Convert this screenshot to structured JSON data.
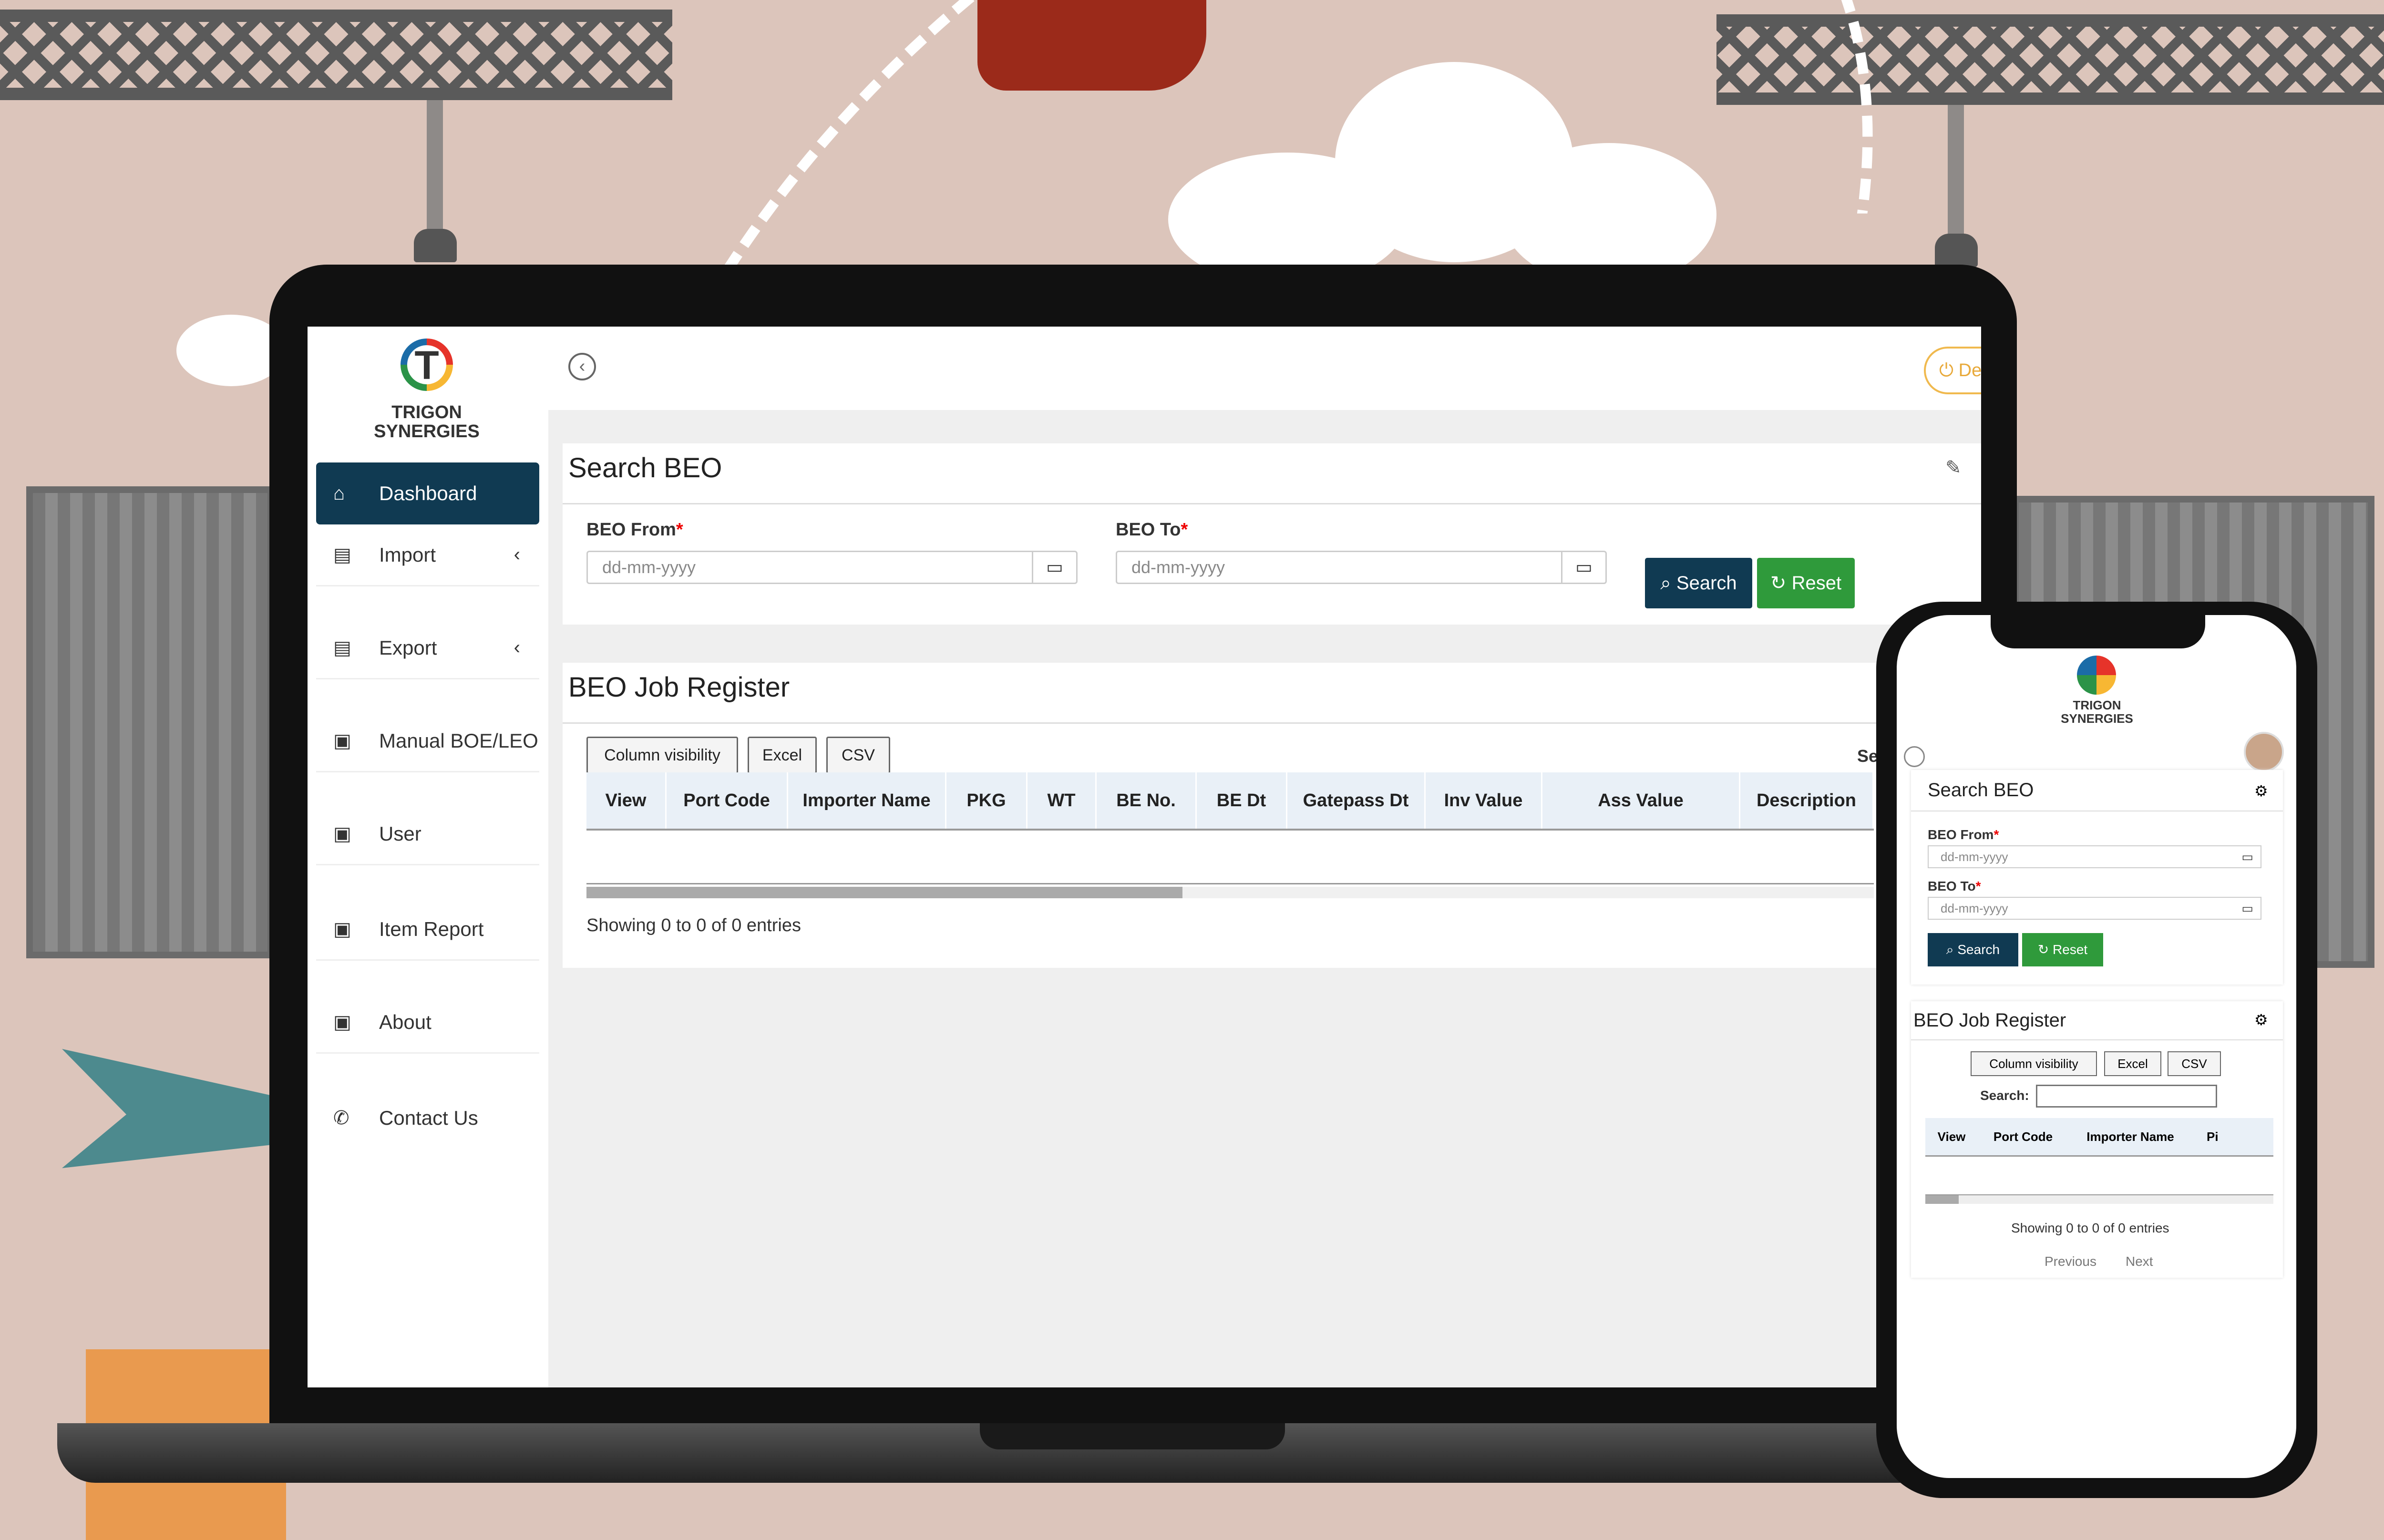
{
  "brand": {
    "line1": "TRIGON",
    "line2": "SYNERGIES",
    "logo_letter": "T"
  },
  "sidebar": {
    "items": [
      {
        "label": "Dashboard",
        "icon": "home-icon",
        "active": true
      },
      {
        "label": "Import",
        "icon": "id-card-icon",
        "chevron": "‹"
      },
      {
        "label": "Export",
        "icon": "id-card-icon",
        "chevron": "‹"
      },
      {
        "label": "Manual BOE/LEO",
        "icon": "clipboard-user-icon"
      },
      {
        "label": "User",
        "icon": "clipboard-user-icon"
      },
      {
        "label": "Item Report",
        "icon": "clipboard-user-icon"
      },
      {
        "label": "About",
        "icon": "clipboard-user-icon"
      },
      {
        "label": "Contact Us",
        "icon": "phone-icon"
      }
    ]
  },
  "topbar": {
    "back_icon": "‹",
    "power_label": "De"
  },
  "search_beo": {
    "title": "Search BEO",
    "from_label": "BEO From",
    "to_label": "BEO To",
    "required_mark": "*",
    "from_placeholder": "dd-mm-yyyy",
    "to_placeholder": "dd-mm-yyyy",
    "search_label": "Search",
    "reset_label": "Reset"
  },
  "register": {
    "title": "BEO Job Register",
    "buttons": [
      "Column visibility",
      "Excel",
      "CSV"
    ],
    "search_partial": "Se",
    "columns": [
      "View",
      "Port Code",
      "Importer Name",
      "PKG",
      "WT",
      "BE No.",
      "BE Dt",
      "Gatepass Dt",
      "Inv Value",
      "Ass Value",
      "Description"
    ],
    "info": "Showing 0 to 0 of 0 entries"
  },
  "mobile": {
    "search_title": "Search BEO",
    "from_label": "BEO From",
    "to_label": "BEO To",
    "placeholder": "dd-mm-yyyy",
    "search_label": "Search",
    "reset_label": "Reset",
    "register_title": "BEO Job Register",
    "buttons": [
      "Column visibility",
      "Excel",
      "CSV"
    ],
    "search_label_text": "Search:",
    "columns": [
      "View",
      "Port Code",
      "Importer Name",
      "Pi"
    ],
    "info": "Showing 0 to 0 of 0 entries",
    "previous": "Previous",
    "next": "Next"
  },
  "colors": {
    "primary": "#103a52",
    "success": "#2f9a3b",
    "accent": "#f0b94e",
    "background": "#dcc5bb"
  }
}
